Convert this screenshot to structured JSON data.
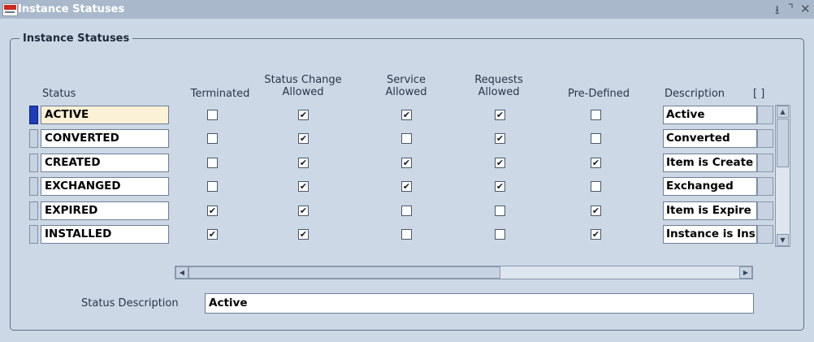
{
  "window": {
    "title": "Instance Statuses",
    "controls": {
      "minimize": "⭳",
      "maximize": "⌝",
      "close": "✕"
    }
  },
  "frame_title": "Instance Statuses",
  "columns": {
    "status": "Status",
    "terminated": "Terminated",
    "status_change_1": "Status Change",
    "status_change_2": "Allowed",
    "service_1": "Service",
    "service_2": "Allowed",
    "requests_1": "Requests",
    "requests_2": "Allowed",
    "predefined": "Pre-Defined",
    "description": "Description",
    "brackets": "[ ]"
  },
  "rows": [
    {
      "status": "ACTIVE",
      "terminated": false,
      "status_change": true,
      "service": true,
      "requests": true,
      "predefined": false,
      "description": "Active",
      "current": true
    },
    {
      "status": "CONVERTED",
      "terminated": false,
      "status_change": true,
      "service": false,
      "requests": true,
      "predefined": false,
      "description": "Converted",
      "current": false
    },
    {
      "status": "CREATED",
      "terminated": false,
      "status_change": true,
      "service": true,
      "requests": true,
      "predefined": true,
      "description": "Item is Create",
      "current": false
    },
    {
      "status": "EXCHANGED",
      "terminated": false,
      "status_change": true,
      "service": true,
      "requests": true,
      "predefined": false,
      "description": "Exchanged",
      "current": false
    },
    {
      "status": "EXPIRED",
      "terminated": true,
      "status_change": true,
      "service": false,
      "requests": false,
      "predefined": true,
      "description": "Item is Expire",
      "current": false
    },
    {
      "status": "INSTALLED",
      "terminated": true,
      "status_change": true,
      "service": false,
      "requests": false,
      "predefined": true,
      "description": "Instance is Ins",
      "current": false
    }
  ],
  "status_description": {
    "label": "Status Description",
    "value": "Active"
  },
  "icons": {
    "check_mark": "✔",
    "arrow_up": "▲",
    "arrow_down": "▼",
    "arrow_left": "◀",
    "arrow_right": "▶"
  }
}
